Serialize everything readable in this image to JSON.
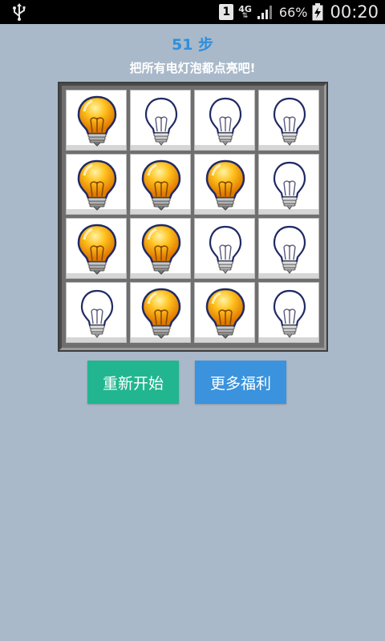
{
  "status_bar": {
    "sim_label": "1",
    "network_type": "4G",
    "network_arrows": "⇅",
    "battery_percent": "66%",
    "time": "00:20",
    "icons": [
      "usb-icon",
      "sim-icon",
      "signal-icon",
      "battery-charging-icon"
    ]
  },
  "header": {
    "steps_text": "51 步",
    "instruction": "把所有电灯泡都点亮吧!"
  },
  "board": {
    "rows": 4,
    "cols": 4,
    "cells": [
      [
        true,
        false,
        false,
        false
      ],
      [
        true,
        true,
        true,
        false
      ],
      [
        true,
        true,
        false,
        false
      ],
      [
        false,
        true,
        true,
        false
      ]
    ]
  },
  "buttons": {
    "restart_label": "重新开始",
    "more_label": "更多福利"
  },
  "colors": {
    "background": "#a9b9ca",
    "step_counter": "#2f8fdc",
    "restart_button": "#21b68f",
    "more_button": "#3a93dc"
  }
}
